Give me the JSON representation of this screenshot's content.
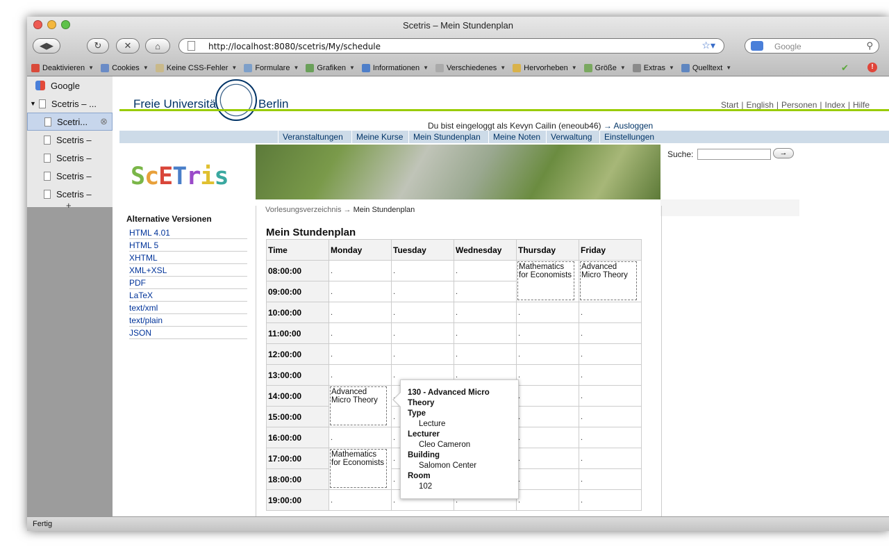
{
  "window": {
    "title": "Scetris – Mein Stundenplan"
  },
  "toolbar": {
    "url": "http://localhost:8080/scetris/My/schedule",
    "search_placeholder": "Google"
  },
  "bookmarks": [
    {
      "label": "Deaktivieren",
      "icon": "disable-icon",
      "color": "#d94a3a"
    },
    {
      "label": "Cookies",
      "icon": "cookies-icon",
      "color": "#6a8bc6"
    },
    {
      "label": "Keine CSS-Fehler",
      "icon": "css-icon",
      "color": "#c9b98a"
    },
    {
      "label": "Formulare",
      "icon": "forms-icon",
      "color": "#7d9fc9"
    },
    {
      "label": "Grafiken",
      "icon": "images-icon",
      "color": "#6aa05a"
    },
    {
      "label": "Informationen",
      "icon": "info-icon",
      "color": "#4f7fc9"
    },
    {
      "label": "Verschiedenes",
      "icon": "misc-icon",
      "color": "#aaaaaa"
    },
    {
      "label": "Hervorheben",
      "icon": "highlight-icon",
      "color": "#d9b24a"
    },
    {
      "label": "Größe",
      "icon": "resize-icon",
      "color": "#7aa860"
    },
    {
      "label": "Extras",
      "icon": "tools-icon",
      "color": "#8a8a8a"
    },
    {
      "label": "Quelltext",
      "icon": "source-icon",
      "color": "#5f86c0"
    }
  ],
  "tab_sidebar": {
    "items": [
      {
        "label": "Google"
      },
      {
        "label": "Scetris – ..."
      },
      {
        "label": "Scetri..."
      },
      {
        "label": "Scetris –"
      },
      {
        "label": "Scetris –"
      },
      {
        "label": "Scetris –"
      },
      {
        "label": "Scetris –"
      }
    ],
    "add_label": "+"
  },
  "status": "Fertig",
  "site": {
    "logo_left": "Freie Universität",
    "logo_right": "Berlin",
    "top_nav": [
      "Start",
      "English",
      "Personen",
      "Index",
      "Hilfe"
    ],
    "login_text": "Du bist eingeloggt als Kevyn Cailin (eneoub46)",
    "logout_label": "→ Ausloggen",
    "main_nav": [
      "Veranstaltungen",
      "Meine Kurse",
      "Mein Stundenplan",
      "Meine Noten",
      "Verwaltung",
      "Einstellungen"
    ],
    "app_logo": "ScETris",
    "search_label": "Suche:",
    "search_button": "→"
  },
  "alternatives": {
    "title": "Alternative Versionen",
    "links": [
      "HTML 4.01",
      "HTML 5",
      "XHTML",
      "XML+XSL",
      "PDF",
      "LaTeX",
      "text/xml",
      "text/plain",
      "JSON"
    ]
  },
  "breadcrumb": {
    "parent": "Vorlesungsverzeichnis",
    "sep": "→",
    "current": "Mein Stundenplan"
  },
  "schedule": {
    "heading": "Mein Stundenplan",
    "columns": [
      "Time",
      "Monday",
      "Tuesday",
      "Wednesday",
      "Thursday",
      "Friday"
    ],
    "times": [
      "08:00:00",
      "09:00:00",
      "10:00:00",
      "11:00:00",
      "12:00:00",
      "13:00:00",
      "14:00:00",
      "15:00:00",
      "16:00:00",
      "17:00:00",
      "18:00:00",
      "19:00:00"
    ],
    "empty_cell": ".",
    "events": [
      {
        "day": "Thursday",
        "start": "08:00:00",
        "title": "Mathematics for Economists"
      },
      {
        "day": "Friday",
        "start": "08:00:00",
        "title": "Advanced Micro Theory"
      },
      {
        "day": "Monday",
        "start": "14:00:00",
        "title": "Advanced Micro Theory"
      },
      {
        "day": "Monday",
        "start": "17:00:00",
        "title": "Mathematics for Economists"
      }
    ]
  },
  "popup": {
    "title": "130 - Advanced Micro Theory",
    "type_label": "Type",
    "type": "Lecture",
    "lecturer_label": "Lecturer",
    "lecturer": "Cleo Cameron",
    "building_label": "Building",
    "building": "Salomon Center",
    "room_label": "Room",
    "room": "102"
  }
}
